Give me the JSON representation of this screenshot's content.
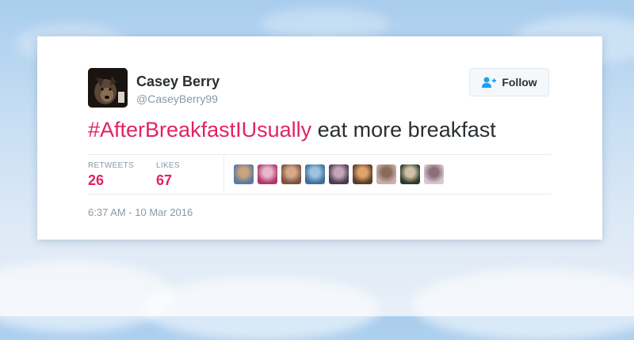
{
  "tweet": {
    "author": {
      "name": "Casey Berry",
      "handle": "@CaseyBerry99"
    },
    "follow_label": "Follow",
    "text": {
      "hashtag": "#AfterBreakfastIUsually",
      "rest": " eat more breakfast"
    },
    "stats": {
      "retweets_label": "RETWEETS",
      "retweets_count": "26",
      "likes_label": "LIKES",
      "likes_count": "67"
    },
    "timestamp": "6:37 AM - 10 Mar 2016"
  },
  "likers": [
    {
      "icon": "liker-avatar",
      "color_a": "#5a7aa0",
      "color_b": "#c9a37a"
    },
    {
      "icon": "liker-avatar",
      "color_a": "#b0386a",
      "color_b": "#e7b7c8"
    },
    {
      "icon": "liker-avatar",
      "color_a": "#7a5340",
      "color_b": "#d9a88a"
    },
    {
      "icon": "liker-avatar",
      "color_a": "#3f6f9a",
      "color_b": "#9cc3e0"
    },
    {
      "icon": "liker-avatar",
      "color_a": "#4a3a52",
      "color_b": "#c7a6b8"
    },
    {
      "icon": "liker-avatar",
      "color_a": "#5c3b2b",
      "color_b": "#e0a36c"
    },
    {
      "icon": "liker-avatar",
      "color_a": "#c9b0a8",
      "color_b": "#8a6a5c"
    },
    {
      "icon": "liker-avatar",
      "color_a": "#2f3a2c",
      "color_b": "#d0c2a8"
    },
    {
      "icon": "liker-avatar",
      "color_a": "#d8c7cf",
      "color_b": "#8c6e7a"
    }
  ],
  "colors": {
    "accent": "#e0245e",
    "text": "#292f33",
    "muted": "#8899a6",
    "follow_icon": "#1da1f2"
  }
}
